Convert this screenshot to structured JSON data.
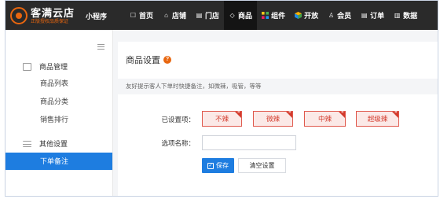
{
  "header": {
    "logo_title": "客满云店",
    "logo_subtitle": "正版授权品质保证",
    "mini_program": "小程序",
    "nav": [
      {
        "label": "首页",
        "icon": "chat-icon"
      },
      {
        "label": "店铺",
        "icon": "home-icon"
      },
      {
        "label": "门店",
        "icon": "store-icon"
      },
      {
        "label": "商品",
        "icon": "tag-icon"
      },
      {
        "label": "组件",
        "icon": "grid-icon"
      },
      {
        "label": "开放",
        "icon": "cube-icon"
      },
      {
        "label": "会员",
        "icon": "user-icon"
      },
      {
        "label": "订单",
        "icon": "list-icon"
      },
      {
        "label": "数据",
        "icon": "chart-icon"
      }
    ],
    "active_nav": "商品"
  },
  "sidebar": {
    "groups": [
      {
        "label": "商品管理",
        "icon": "box-icon",
        "items": [
          "商品列表",
          "商品分类",
          "销售排行"
        ]
      },
      {
        "label": "其他设置",
        "icon": "sliders-icon",
        "items": [
          "下单备注"
        ]
      }
    ],
    "active_item": "下单备注"
  },
  "main": {
    "title": "商品设置",
    "help_icon": "?",
    "hint": "友好提示客人下单时快捷备注，如微辣，吸管，等等",
    "set_options_label": "已设置项：",
    "tags": [
      "不辣",
      "微辣",
      "中辣",
      "超级辣"
    ],
    "option_name_label": "选项名称：",
    "option_name_value": "",
    "save_label": "保存",
    "clear_label": "清空设置"
  },
  "colors": {
    "topbar": "#2a2a2a",
    "accent": "#1e7de0",
    "brand": "#e8660f",
    "tag_border": "#e05a4e"
  }
}
